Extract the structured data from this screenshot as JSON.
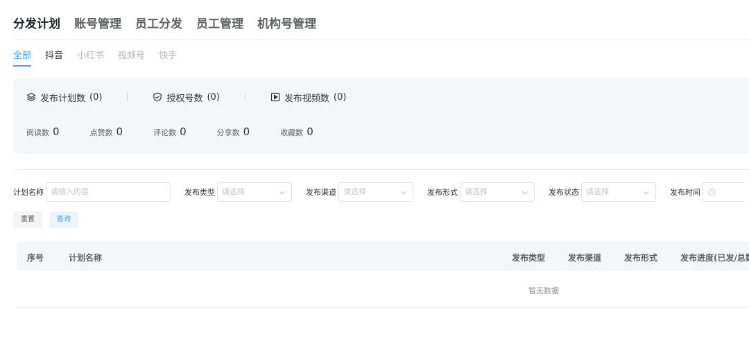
{
  "top_nav": {
    "items": [
      {
        "label": "分发计划"
      },
      {
        "label": "账号管理"
      },
      {
        "label": "员工分发"
      },
      {
        "label": "员工管理"
      },
      {
        "label": "机构号管理"
      }
    ]
  },
  "platform_tabs": [
    {
      "label": "全部"
    },
    {
      "label": "抖音"
    },
    {
      "label": "小红书"
    },
    {
      "label": "视频号"
    },
    {
      "label": "快手"
    }
  ],
  "stats": {
    "plan_count": {
      "label": "发布计划数",
      "count": "(0)",
      "icon": "layers-icon"
    },
    "auth_count": {
      "label": "授权号数",
      "count": "(0)",
      "icon": "shield-check-icon"
    },
    "video_count": {
      "label": "发布视频数",
      "count": "(0)",
      "icon": "play-square-icon"
    },
    "metrics": [
      {
        "label": "阅读数",
        "value": "0"
      },
      {
        "label": "点赞数",
        "value": "0"
      },
      {
        "label": "评论数",
        "value": "0"
      },
      {
        "label": "分享数",
        "value": "0"
      },
      {
        "label": "收藏数",
        "value": "0"
      }
    ]
  },
  "filters": {
    "plan_name": {
      "label": "计划名称",
      "placeholder": "请输入内容"
    },
    "publish_type": {
      "label": "发布类型",
      "placeholder": "请选择"
    },
    "publish_channel": {
      "label": "发布渠道",
      "placeholder": "请选择"
    },
    "publish_form": {
      "label": "发布形式",
      "placeholder": "请选择"
    },
    "publish_status": {
      "label": "发布状态",
      "placeholder": "请选择"
    },
    "publish_time": {
      "label": "发布时间",
      "icon": "clock-icon"
    }
  },
  "buttons": {
    "reset": "重置",
    "query": "查询"
  },
  "table": {
    "columns": [
      "序号",
      "计划名称",
      "发布类型",
      "发布渠道",
      "发布形式",
      "发布进度(已发/总数)"
    ],
    "empty_text": "暂无数据"
  }
}
